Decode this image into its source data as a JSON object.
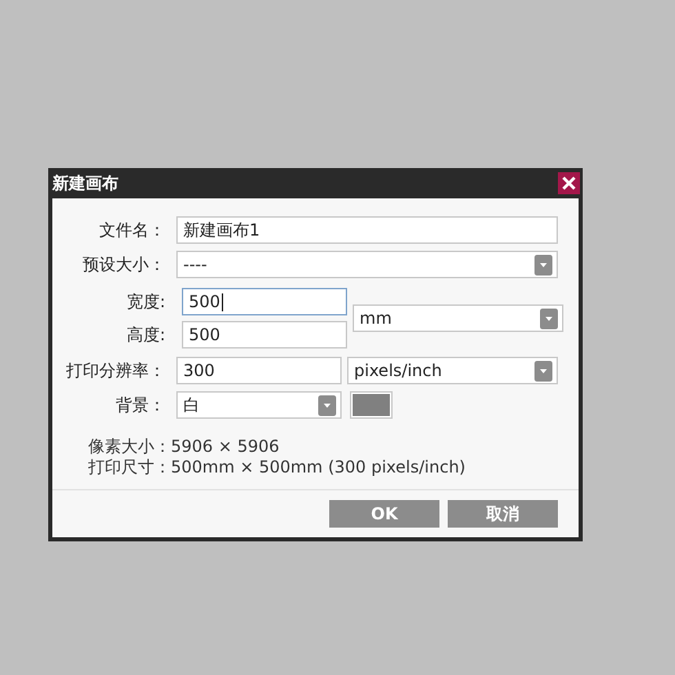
{
  "window": {
    "title": "新建画布"
  },
  "fields": [
    {
      "kind": "text",
      "label": "文件名：",
      "value": "新建画布1",
      "focused": false
    },
    {
      "kind": "select",
      "label": "预设大小：",
      "value": "----"
    }
  ],
  "size": {
    "width": {
      "label": "宽度:",
      "value": "500",
      "focused": true
    },
    "height": {
      "label": "高度:",
      "value": "500",
      "focused": false
    },
    "unit": {
      "value": "mm"
    }
  },
  "resolution": {
    "label": "打印分辨率：",
    "value": "300",
    "unit": "pixels/inch"
  },
  "background": {
    "label": "背景：",
    "value": "白",
    "color": "#808080"
  },
  "info": [
    {
      "label": "像素大小：",
      "value": "5906 × 5906"
    },
    {
      "label": "打印尺寸：",
      "value": "500mm × 500mm (300 pixels/inch)"
    }
  ],
  "buttons": [
    "OK",
    "取消"
  ]
}
